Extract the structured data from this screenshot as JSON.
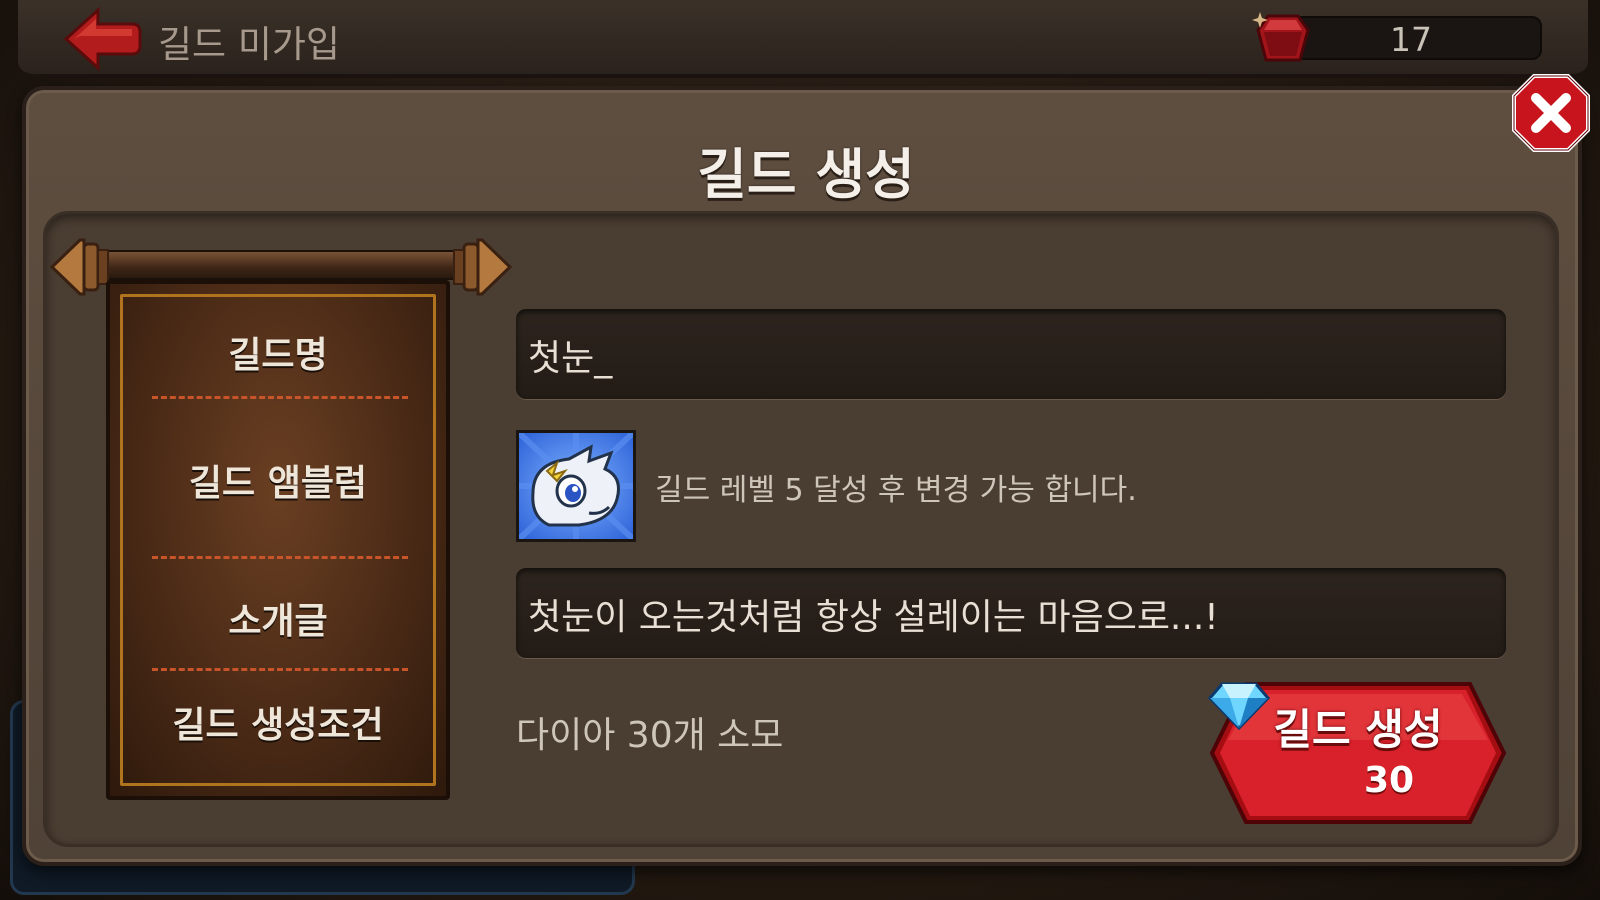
{
  "topbar": {
    "title": "길드 미가입",
    "gem_count": "17"
  },
  "modal": {
    "title": "길드 생성"
  },
  "menu": {
    "items": [
      {
        "label": "길드명"
      },
      {
        "label": "길드 앰블럼"
      },
      {
        "label": "소개글"
      },
      {
        "label": "길드 생성조건"
      }
    ]
  },
  "form": {
    "guild_name_value": "첫눈_",
    "emblem_note": "길드 레벨 5 달성 후 변경 가능 합니다.",
    "intro_value": "첫눈이 오는것처럼 항상 설레이는 마음으로...!",
    "condition_text": "다이아 30개 소모"
  },
  "create_button": {
    "label": "길드 생성",
    "cost": "30"
  },
  "colors": {
    "accent_red": "#d8212a",
    "scroll_border": "#b0741e",
    "divider": "#c8552a"
  },
  "icons": [
    "back-arrow-icon",
    "ruby-icon",
    "close-icon",
    "dragon-emblem-icon",
    "diamond-icon"
  ]
}
